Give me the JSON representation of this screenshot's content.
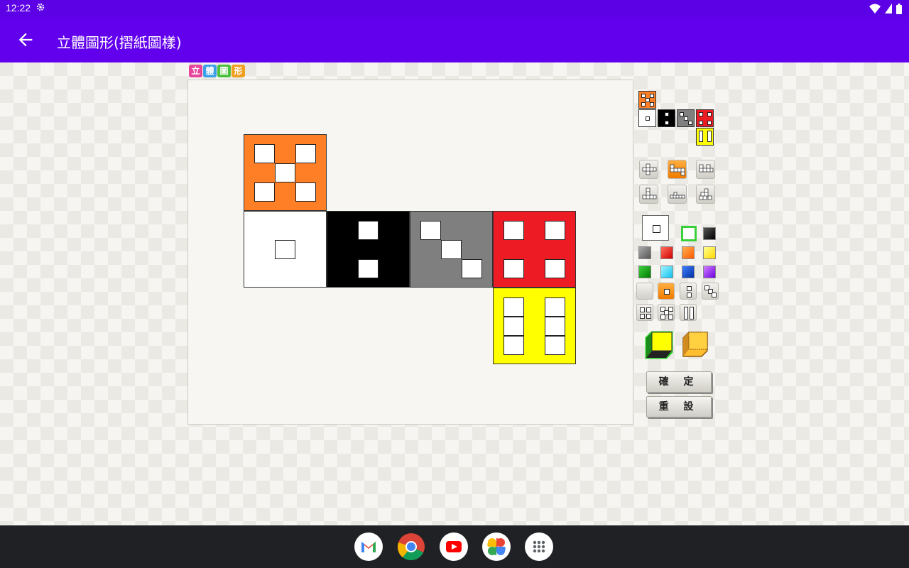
{
  "status_bar": {
    "time": "12:22"
  },
  "app_bar": {
    "title": "立體圖形(摺紙圖樣)"
  },
  "logo_chars": [
    "立",
    "體",
    "圖",
    "形"
  ],
  "buttons": {
    "confirm": "確 定",
    "reset": "重 設"
  },
  "colors": {
    "orange": "#ff7f27",
    "black": "#000000",
    "gray": "#7f7f7f",
    "red": "#ed1c24",
    "yellow": "#ffff00",
    "white": "#ffffff"
  },
  "palette": [
    "#ffffff",
    "#ffffff",
    "#000000",
    "#808080",
    "#ff2000",
    "#ff7000",
    "#ffff00",
    "#00a000",
    "#30d8ff",
    "#0040c0",
    "#9020ff"
  ],
  "dock_apps": [
    "gmail-icon",
    "chrome-icon",
    "youtube-icon",
    "photos-icon",
    "app-drawer-icon"
  ]
}
